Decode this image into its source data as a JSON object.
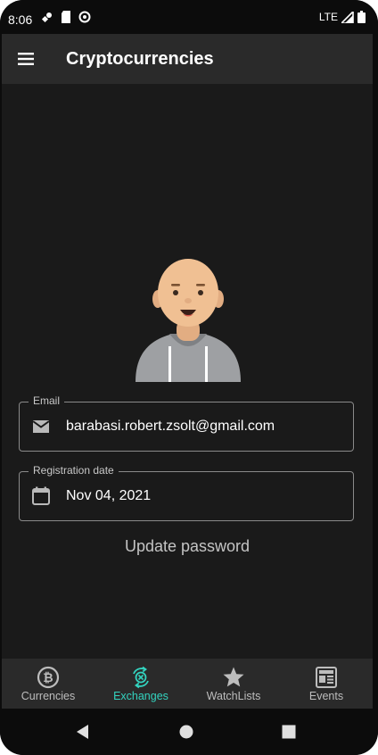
{
  "status_bar": {
    "time": "8:06",
    "network": "LTE"
  },
  "app_bar": {
    "title": "Cryptocurrencies",
    "menu_icon": "hamburger-menu-icon"
  },
  "profile": {
    "email": {
      "label": "Email",
      "value": "barabasi.robert.zsolt@gmail.com",
      "icon": "email-icon"
    },
    "registration_date": {
      "label": "Registration date",
      "value": "Nov 04, 2021",
      "icon": "calendar-icon"
    },
    "update_password_label": "Update password"
  },
  "bottom_nav": {
    "items": [
      {
        "label": "Currencies",
        "icon": "bitcoin-icon",
        "active": false
      },
      {
        "label": "Exchanges",
        "icon": "exchange-icon",
        "active": true
      },
      {
        "label": "WatchLists",
        "icon": "star-icon",
        "active": false
      },
      {
        "label": "Events",
        "icon": "newspaper-icon",
        "active": false
      }
    ]
  },
  "colors": {
    "background": "#1a1a1a",
    "app_bar": "#2a2a2a",
    "accent": "#33d3bf",
    "text": "#ffffff",
    "muted_text": "#bdbdbd"
  }
}
